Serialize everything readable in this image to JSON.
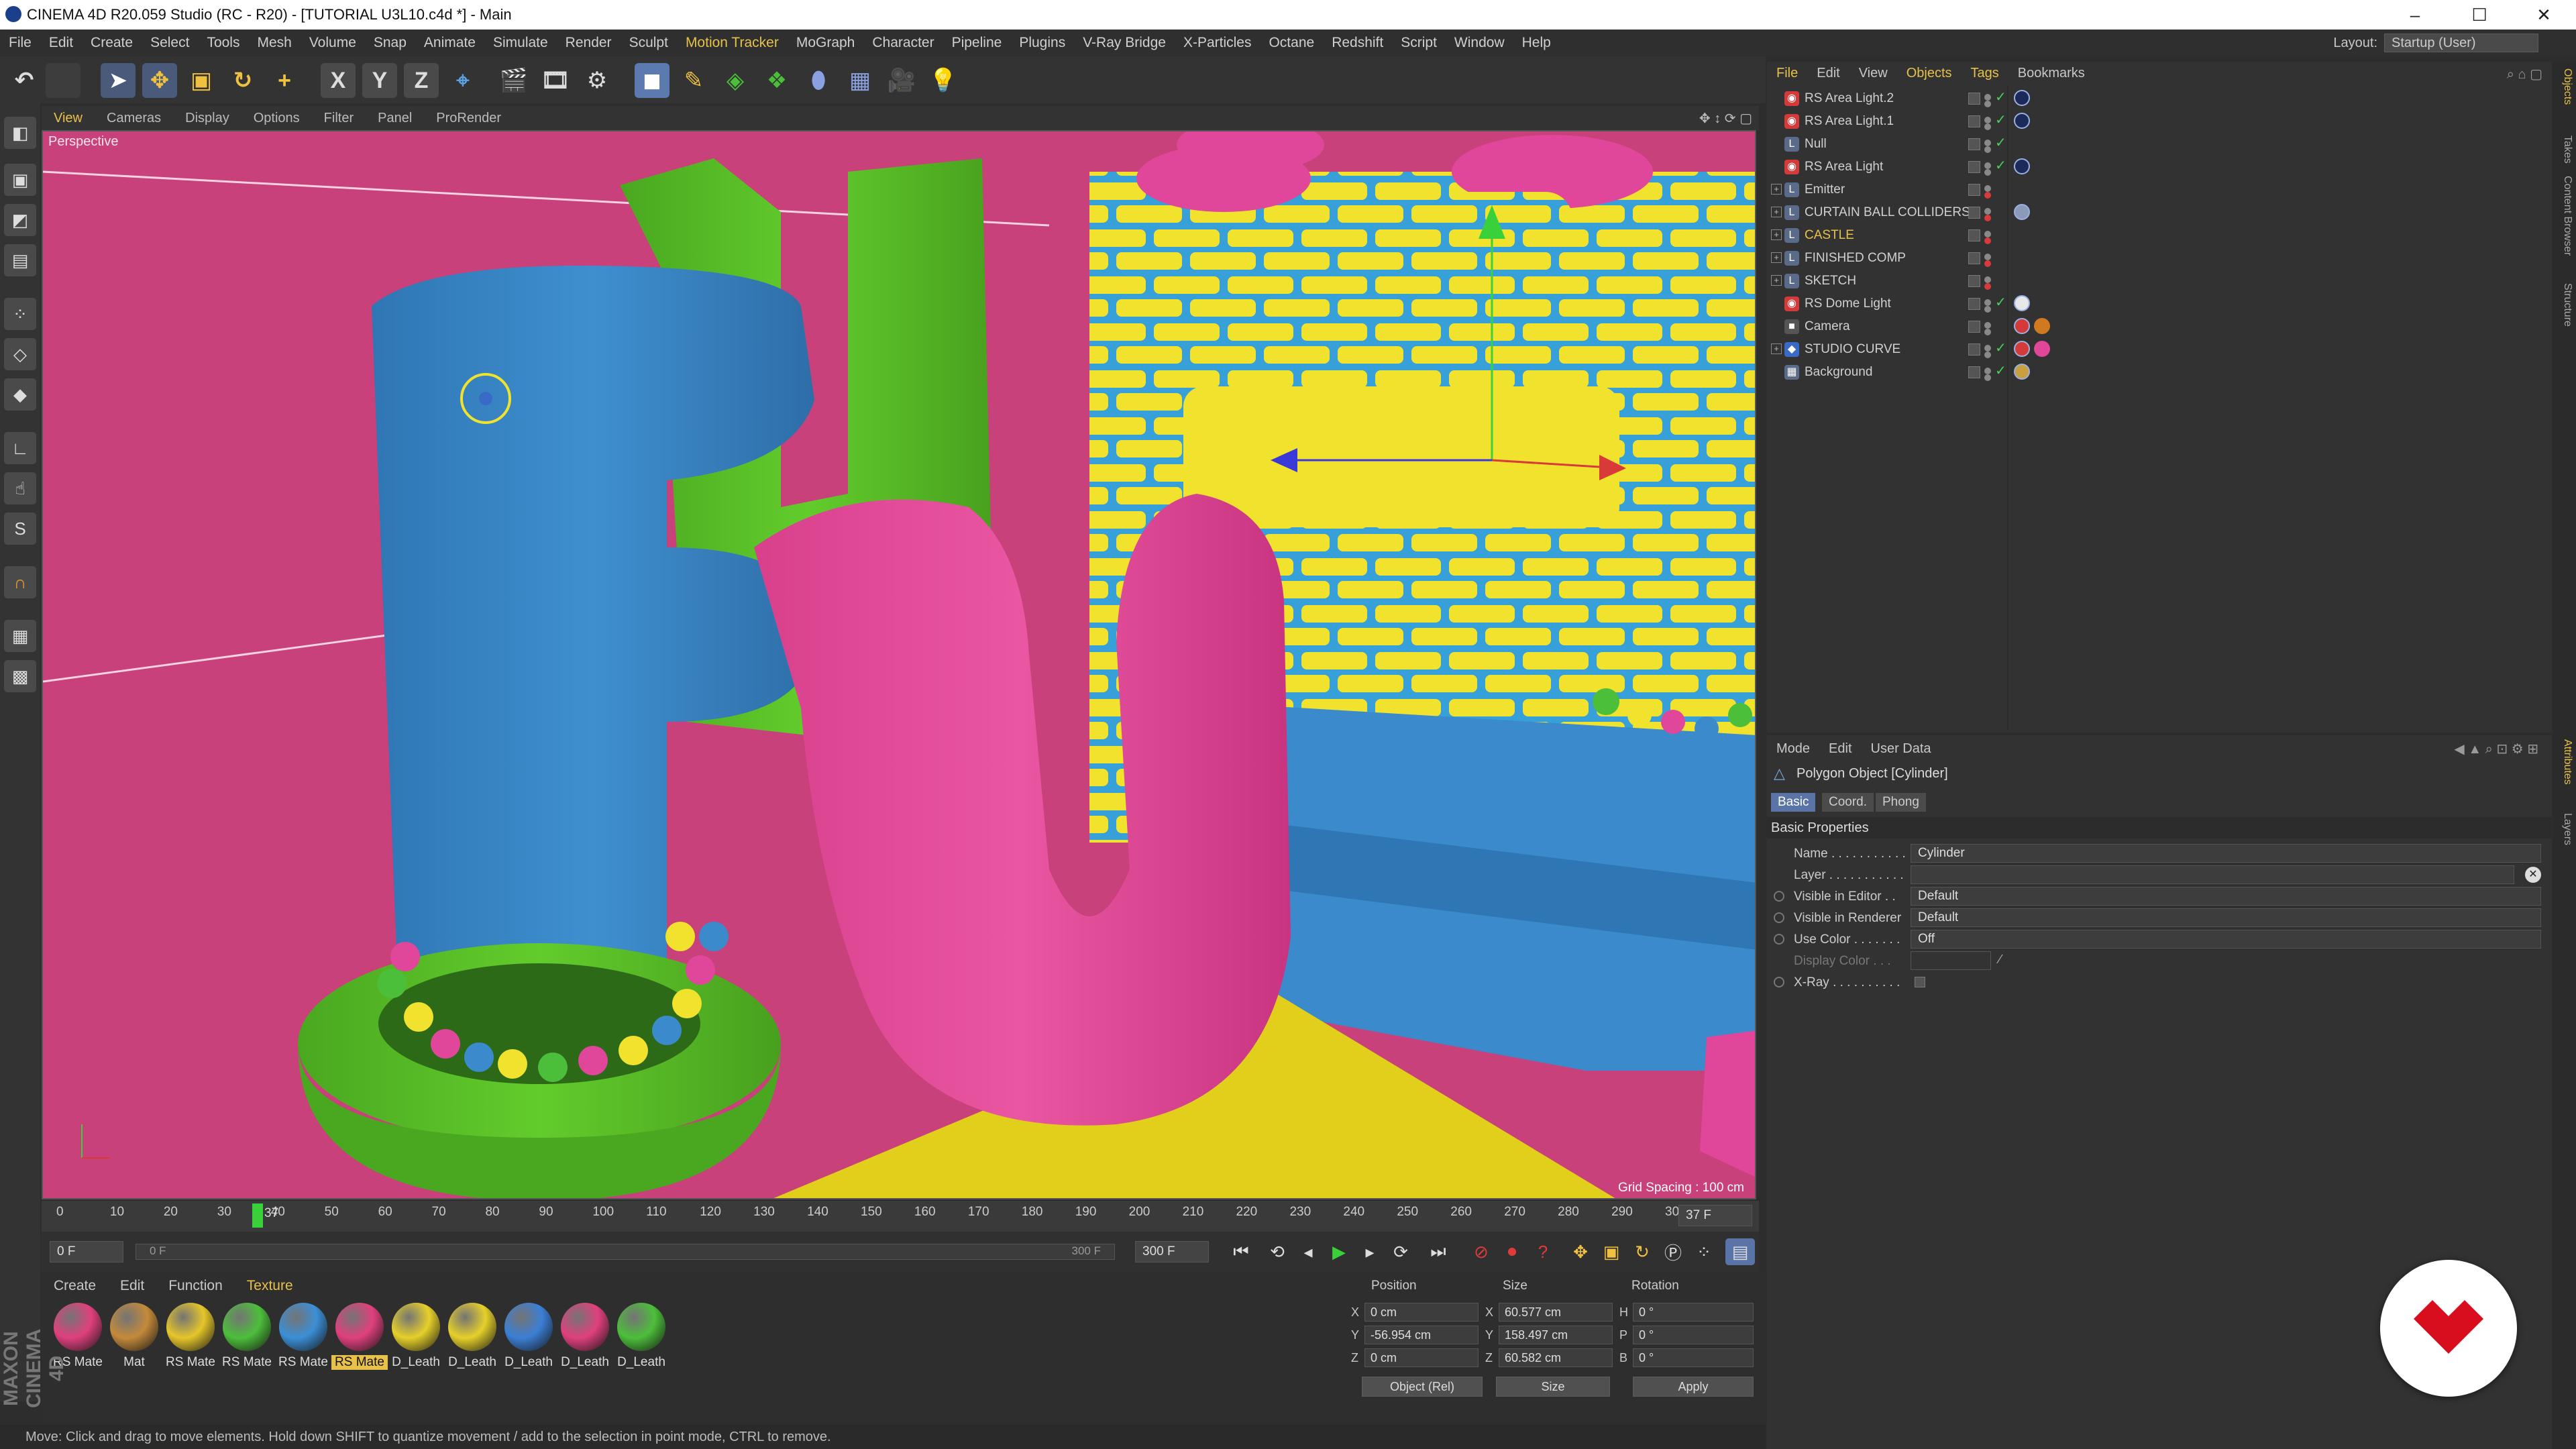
{
  "window": {
    "title": "CINEMA 4D R20.059 Studio (RC - R20) - [TUTORIAL U3L10.c4d *] - Main",
    "minimize": "–",
    "maximize": "☐",
    "close": "✕"
  },
  "menu": [
    "File",
    "Edit",
    "Create",
    "Select",
    "Tools",
    "Mesh",
    "Volume",
    "Snap",
    "Animate",
    "Simulate",
    "Render",
    "Sculpt",
    "Motion Tracker",
    "MoGraph",
    "Character",
    "Pipeline",
    "Plugins",
    "V-Ray Bridge",
    "X-Particles",
    "Octane",
    "Redshift",
    "Script",
    "Window",
    "Help"
  ],
  "menu_highlight": "Motion Tracker",
  "layout": {
    "label": "Layout:",
    "value": "Startup (User)"
  },
  "toolbar": {
    "axis_x": "X",
    "axis_y": "Y",
    "axis_z": "Z"
  },
  "viewport": {
    "menu": [
      "View",
      "Cameras",
      "Display",
      "Options",
      "Filter",
      "Panel",
      "ProRender"
    ],
    "camera_label": "Perspective",
    "grid_spacing": "Grid Spacing : 100 cm"
  },
  "timeline": {
    "ticks": [
      "0",
      "10",
      "20",
      "30",
      "40",
      "50",
      "60",
      "70",
      "80",
      "90",
      "100",
      "110",
      "120",
      "130",
      "140",
      "150",
      "160",
      "170",
      "180",
      "190",
      "200",
      "210",
      "220",
      "230",
      "240",
      "250",
      "260",
      "270",
      "280",
      "290",
      "300"
    ],
    "current_frame_marker": "37",
    "current_frame_field": "37 F",
    "start_field": "0 F",
    "range_start": "0 F",
    "range_end": "300 F",
    "end_field": "300 F"
  },
  "materials": {
    "menu": [
      "Create",
      "Edit",
      "Function",
      "Texture"
    ],
    "menu_highlight": "Texture",
    "items": [
      {
        "label": "RS Mate",
        "color": "#e0407e"
      },
      {
        "label": "Mat",
        "color": "#c48a3a"
      },
      {
        "label": "RS Mate",
        "color": "#e6c62a"
      },
      {
        "label": "RS Mate",
        "color": "#4cbf3a"
      },
      {
        "label": "RS Mate",
        "color": "#3b8fd6"
      },
      {
        "label": "RS Mate",
        "color": "#e0407e",
        "selected": true
      },
      {
        "label": "D_Leath",
        "color": "#e6d02a"
      },
      {
        "label": "D_Leath",
        "color": "#e6d02a"
      },
      {
        "label": "D_Leath",
        "color": "#3b7fd6"
      },
      {
        "label": "D_Leath",
        "color": "#e0407e"
      },
      {
        "label": "D_Leath",
        "color": "#4cbf3a"
      }
    ]
  },
  "maxon_brand": "MAXON CINEMA 4D",
  "coords": {
    "headers": {
      "position": "Position",
      "size": "Size",
      "rotation": "Rotation"
    },
    "rows": [
      {
        "axis": "X",
        "pos": "0 cm",
        "size_axis": "X",
        "size": "60.577 cm",
        "rot_axis": "H",
        "rot": "0 °"
      },
      {
        "axis": "Y",
        "pos": "-56.954 cm",
        "size_axis": "Y",
        "size": "158.497 cm",
        "rot_axis": "P",
        "rot": "0 °"
      },
      {
        "axis": "Z",
        "pos": "0 cm",
        "size_axis": "Z",
        "size": "60.582 cm",
        "rot_axis": "B",
        "rot": "0 °"
      }
    ],
    "mode_select": "Object (Rel)",
    "size_select": "Size",
    "apply": "Apply"
  },
  "status": "Move: Click and drag to move elements. Hold down SHIFT to quantize movement / add to the selection in point mode, CTRL to remove.",
  "objects": {
    "menu": [
      "File",
      "Edit",
      "View",
      "Objects",
      "Tags",
      "Bookmarks"
    ],
    "menu_highlight": [
      "File",
      "Objects",
      "Tags"
    ],
    "items": [
      {
        "name": "RS Area Light.2",
        "icon": "#d43a3a",
        "glyph": "◉",
        "expand": "",
        "tag": "#1b2a5a"
      },
      {
        "name": "RS Area Light.1",
        "icon": "#d43a3a",
        "glyph": "◉",
        "expand": "",
        "tag": "#1b2a5a"
      },
      {
        "name": "Null",
        "icon": "#5a6a8a",
        "glyph": "L",
        "expand": "",
        "tag": ""
      },
      {
        "name": "RS Area Light",
        "icon": "#d43a3a",
        "glyph": "◉",
        "expand": "",
        "tag": "#1b2a5a"
      },
      {
        "name": "Emitter",
        "icon": "#5a6a8a",
        "glyph": "L",
        "expand": "+",
        "tag": ""
      },
      {
        "name": "CURTAIN BALL COLLIDERS",
        "icon": "#5a6a8a",
        "glyph": "L",
        "expand": "+",
        "tag": "#8a9ab8"
      },
      {
        "name": "CASTLE",
        "icon": "#5a6a8a",
        "glyph": "L",
        "expand": "+",
        "tag": "",
        "highlight": true
      },
      {
        "name": "FINISHED COMP",
        "icon": "#5a6a8a",
        "glyph": "L",
        "expand": "+",
        "tag": ""
      },
      {
        "name": "SKETCH",
        "icon": "#5a6a8a",
        "glyph": "L",
        "expand": "+",
        "tag": ""
      },
      {
        "name": "RS Dome Light",
        "icon": "#d43a3a",
        "glyph": "◉",
        "expand": "",
        "tag": "#e8e8e8"
      },
      {
        "name": "Camera",
        "icon": "#555",
        "glyph": "■",
        "expand": "",
        "tag": "#d43a3a"
      },
      {
        "name": "STUDIO CURVE",
        "icon": "#3a6ac8",
        "glyph": "◆",
        "expand": "+",
        "tag": "#d43a3a"
      },
      {
        "name": "Background",
        "icon": "#5a6a8a",
        "glyph": "▦",
        "expand": "",
        "tag": "#c8a040"
      }
    ]
  },
  "attributes": {
    "menu": [
      "Mode",
      "Edit",
      "User Data"
    ],
    "object_title": "Polygon Object [Cylinder]",
    "tabs": [
      "Basic",
      "Coord.",
      "Phong"
    ],
    "active_tab": "Basic",
    "section": "Basic Properties",
    "fields": [
      {
        "label": "Name . . . . . . . . . . .",
        "value": "Cylinder"
      },
      {
        "label": "Layer . . . . . . . . . . .",
        "value": ""
      },
      {
        "label": "Visible in Editor . .",
        "value": "Default"
      },
      {
        "label": "Visible in Renderer",
        "value": "Default"
      },
      {
        "label": "Use Color . . . . . . .",
        "value": "Off"
      },
      {
        "label": "Display Color . . .",
        "value": ""
      },
      {
        "label": "X-Ray . . . . . . . . . .",
        "value": ""
      }
    ]
  },
  "right_tabs": [
    "Objects",
    "Takes",
    "Content Browser",
    "Structure",
    "Attributes",
    "Layers"
  ],
  "colors": {
    "accent": "#e7c14a",
    "viewport_bg": "#c8417a",
    "blue_letter": "#3b86c4",
    "pink_letter": "#e0469a",
    "green": "#5cc62a",
    "yellow": "#f0e02a"
  }
}
